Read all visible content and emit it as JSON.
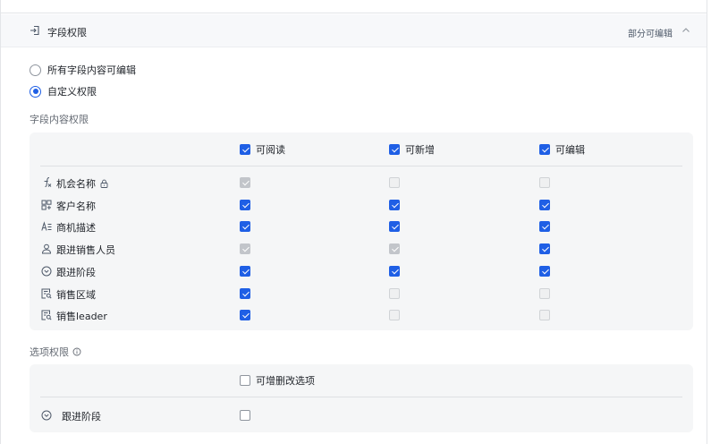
{
  "header": {
    "title": "字段权限",
    "status": "部分可编辑"
  },
  "permission_mode": {
    "options": [
      {
        "label": "所有字段内容可编辑",
        "selected": false
      },
      {
        "label": "自定义权限",
        "selected": true
      }
    ]
  },
  "field_permissions": {
    "title": "字段内容权限",
    "columns": [
      {
        "label": "可阅读",
        "state": "checked"
      },
      {
        "label": "可新增",
        "state": "checked"
      },
      {
        "label": "可编辑",
        "state": "checked"
      }
    ],
    "rows": [
      {
        "name": "机会名称",
        "icon": "formula-icon",
        "locked": true,
        "states": [
          "checked-disabled",
          "disabled",
          "disabled"
        ]
      },
      {
        "name": "客户名称",
        "icon": "lookup-icon",
        "locked": false,
        "states": [
          "checked",
          "checked",
          "checked"
        ]
      },
      {
        "name": "商机描述",
        "icon": "text-icon",
        "locked": false,
        "states": [
          "checked",
          "checked",
          "checked"
        ]
      },
      {
        "name": "跟进销售人员",
        "icon": "person-icon",
        "locked": false,
        "states": [
          "checked-disabled",
          "checked-disabled",
          "checked"
        ]
      },
      {
        "name": "跟进阶段",
        "icon": "select-icon",
        "locked": false,
        "states": [
          "checked",
          "checked",
          "checked"
        ]
      },
      {
        "name": "销售区域",
        "icon": "lookup-field-icon",
        "locked": false,
        "states": [
          "checked",
          "disabled",
          "disabled"
        ]
      },
      {
        "name": "销售leader",
        "icon": "lookup-field-icon",
        "locked": false,
        "states": [
          "checked",
          "disabled",
          "disabled"
        ]
      }
    ]
  },
  "option_permissions": {
    "title": "选项权限",
    "column": {
      "label": "可增删改选项",
      "state": "unchecked"
    },
    "rows": [
      {
        "name": "跟进阶段",
        "icon": "select-icon",
        "states": [
          "unchecked"
        ]
      }
    ]
  },
  "colors": {
    "accent": "#1f5fe5",
    "panel_bg": "#f5f6f7",
    "checked_disabled": "#c2c5ca"
  }
}
